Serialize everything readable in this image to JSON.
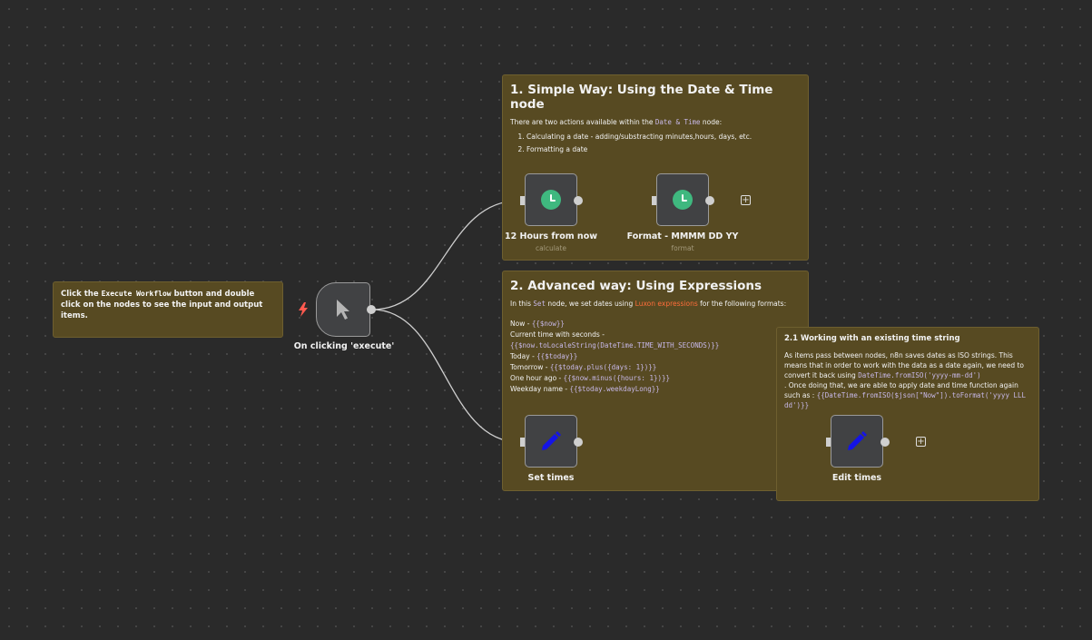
{
  "colors": {
    "canvas": "#2a2a2a",
    "sticky": "#574a22",
    "node": "#414244",
    "clock": "#3fb87f",
    "pencil": "#1414e6",
    "luxon_link": "#ff6d3a",
    "trigger_bolt": "#ff5a4f"
  },
  "intro_note": {
    "before": "Click the ",
    "code": "Execute Workflow",
    "after": " button and double click on the nodes to see the input and output items."
  },
  "simple_note": {
    "title": "1. Simple Way: Using the Date & Time node",
    "desc_before": "There are two actions available within the ",
    "desc_code": "Date & Time",
    "desc_after": " node:",
    "items": [
      "Calculating a date - adding/substracting minutes,hours, days, etc.",
      "Formatting a date"
    ]
  },
  "advanced_note": {
    "title": "2. Advanced way: Using Expressions",
    "intro_before": "In this ",
    "intro_code": "Set",
    "intro_mid": " node, we set dates using ",
    "intro_link": "Luxon expressions",
    "intro_after": " for the following formats:",
    "lines": [
      {
        "label": "Now - ",
        "code": "{{$now}}"
      },
      {
        "label": "Current time with seconds - ",
        "code": ""
      },
      {
        "label": "",
        "code": "{{$now.toLocaleString(DateTime.TIME_WITH_SECONDS)}}"
      },
      {
        "label": "Today - ",
        "code": "{{$today}}"
      },
      {
        "label": "Tomorrow - ",
        "code": "{{$today.plus({days: 1})}}"
      },
      {
        "label": "One hour ago - ",
        "code": "{{$now.minus({hours: 1})}}"
      },
      {
        "label": "Weekday name - ",
        "code": "{{$today.weekdayLong}}"
      }
    ]
  },
  "existing_note": {
    "title": "2.1 Working with an existing time string",
    "p1": "As items pass between nodes, n8n saves dates as ISO strings. This means that in order to work with the data as a date again, we need to convert it back using ",
    "p1_code": "DateTime.fromISO('yyyy-mm-dd')",
    "p2": ". Once doing that, we are able to apply date and time function again such as : ",
    "p2_code": "{{DateTime.fromISO($json[\"Now\"]).toFormat('yyyy LLL dd')}}"
  },
  "nodes": {
    "trigger": {
      "label": "On clicking 'execute'",
      "icon": "cursor-icon"
    },
    "hours": {
      "label": "12 Hours from now",
      "sub": "calculate",
      "icon": "clock-icon"
    },
    "format": {
      "label": "Format - MMMM DD YY",
      "sub": "format",
      "icon": "clock-icon"
    },
    "set_times": {
      "label": "Set times",
      "icon": "pencil-icon"
    },
    "edit_times": {
      "label": "Edit times",
      "icon": "pencil-icon"
    }
  },
  "add_symbol": "+"
}
